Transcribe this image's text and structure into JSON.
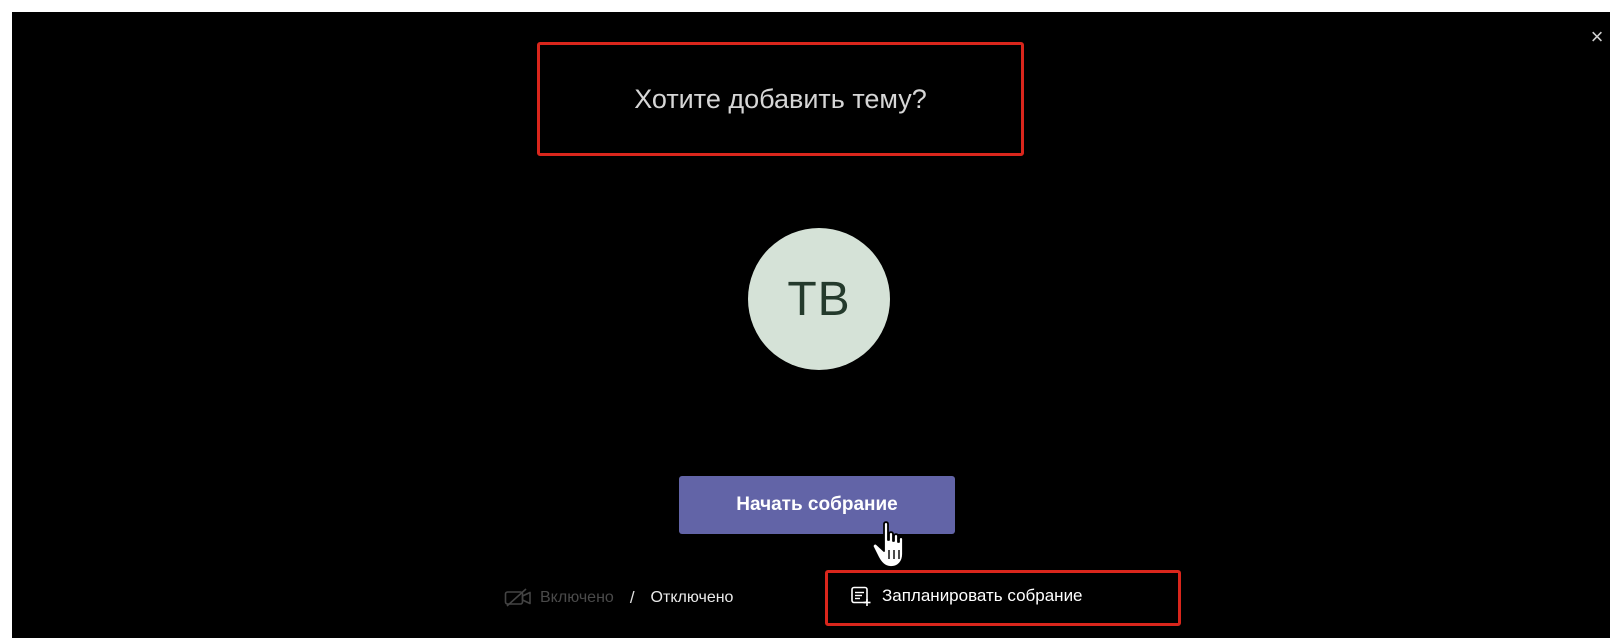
{
  "dialog": {
    "close_glyph": "×",
    "topic_placeholder": "Хотите добавить тему?",
    "avatar_initials": "TB",
    "start_button_label": "Начать собрание",
    "video_on_label": "Включено",
    "video_separator": "/",
    "video_off_label": "Отключено",
    "schedule_label": "Запланировать собрание"
  },
  "icons": {
    "close": "close-icon",
    "camera": "camera-icon",
    "calendar": "calendar-icon",
    "cursor": "hand-cursor-icon"
  },
  "colors": {
    "background": "#000000",
    "highlight_border": "#d9261c",
    "start_button": "#6264a7",
    "avatar_bg": "#d5e2d7",
    "avatar_text": "#243a2c"
  }
}
